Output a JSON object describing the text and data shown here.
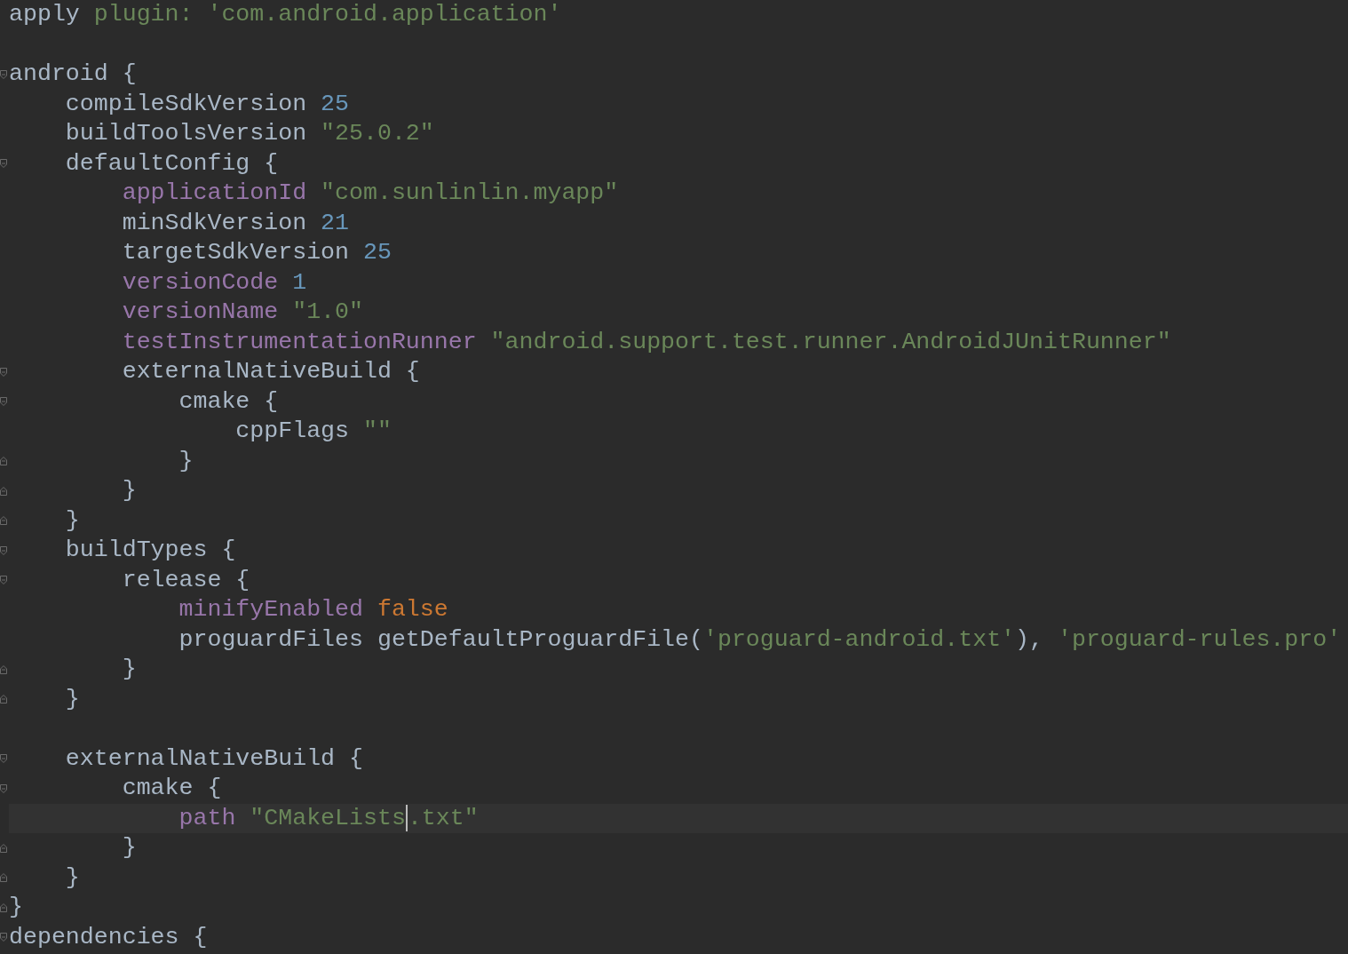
{
  "editor": {
    "lines": [
      {
        "fold_open": false,
        "fold_close": false,
        "tokens": [
          {
            "kind": "plain",
            "text": "apply "
          },
          {
            "kind": "string",
            "text": "plugin: 'com.android.application'"
          }
        ]
      },
      {
        "fold_open": false,
        "fold_close": false
      },
      {
        "fold_open": true,
        "fold_close": false,
        "tokens": [
          {
            "kind": "plain",
            "text": "android {"
          }
        ]
      },
      {
        "fold_open": false,
        "fold_close": false,
        "tokens": [
          {
            "kind": "plain",
            "text": "    compileSdkVersion "
          },
          {
            "kind": "number",
            "text": "25"
          }
        ]
      },
      {
        "fold_open": false,
        "fold_close": false,
        "tokens": [
          {
            "kind": "plain",
            "text": "    buildToolsVersion "
          },
          {
            "kind": "string",
            "text": "\"25.0.2\""
          }
        ]
      },
      {
        "fold_open": true,
        "fold_close": false,
        "tokens": [
          {
            "kind": "plain",
            "text": "    defaultConfig {"
          }
        ]
      },
      {
        "fold_open": false,
        "fold_close": false,
        "tokens": [
          {
            "kind": "property",
            "text": "        applicationId "
          },
          {
            "kind": "string",
            "text": "\"com.sunlinlin.myapp\""
          }
        ]
      },
      {
        "fold_open": false,
        "fold_close": false,
        "tokens": [
          {
            "kind": "plain",
            "text": "        minSdkVersion "
          },
          {
            "kind": "number",
            "text": "21"
          }
        ]
      },
      {
        "fold_open": false,
        "fold_close": false,
        "tokens": [
          {
            "kind": "plain",
            "text": "        targetSdkVersion "
          },
          {
            "kind": "number",
            "text": "25"
          }
        ]
      },
      {
        "fold_open": false,
        "fold_close": false,
        "tokens": [
          {
            "kind": "property",
            "text": "        versionCode "
          },
          {
            "kind": "number",
            "text": "1"
          }
        ]
      },
      {
        "fold_open": false,
        "fold_close": false,
        "tokens": [
          {
            "kind": "property",
            "text": "        versionName "
          },
          {
            "kind": "string",
            "text": "\"1.0\""
          }
        ]
      },
      {
        "fold_open": false,
        "fold_close": false,
        "tokens": [
          {
            "kind": "property",
            "text": "        testInstrumentationRunner "
          },
          {
            "kind": "string",
            "text": "\"android.support.test.runner.AndroidJUnitRunner\""
          }
        ]
      },
      {
        "fold_open": true,
        "fold_close": false,
        "tokens": [
          {
            "kind": "plain",
            "text": "        externalNativeBuild {"
          }
        ]
      },
      {
        "fold_open": true,
        "fold_close": false,
        "tokens": [
          {
            "kind": "plain",
            "text": "            cmake {"
          }
        ]
      },
      {
        "fold_open": false,
        "fold_close": false,
        "tokens": [
          {
            "kind": "plain",
            "text": "                cppFlags "
          },
          {
            "kind": "string",
            "text": "\"\""
          }
        ]
      },
      {
        "fold_open": false,
        "fold_close": true,
        "tokens": [
          {
            "kind": "plain",
            "text": "            }"
          }
        ]
      },
      {
        "fold_open": false,
        "fold_close": true,
        "tokens": [
          {
            "kind": "plain",
            "text": "        }"
          }
        ]
      },
      {
        "fold_open": false,
        "fold_close": true,
        "tokens": [
          {
            "kind": "plain",
            "text": "    }"
          }
        ]
      },
      {
        "fold_open": true,
        "fold_close": false,
        "tokens": [
          {
            "kind": "plain",
            "text": "    buildTypes {"
          }
        ]
      },
      {
        "fold_open": true,
        "fold_close": false,
        "tokens": [
          {
            "kind": "plain",
            "text": "        release {"
          }
        ]
      },
      {
        "fold_open": false,
        "fold_close": false,
        "tokens": [
          {
            "kind": "property",
            "text": "            minifyEnabled "
          },
          {
            "kind": "keyword",
            "text": "false"
          }
        ]
      },
      {
        "fold_open": false,
        "fold_close": false,
        "tokens": [
          {
            "kind": "plain",
            "text": "            proguardFiles getDefaultProguardFile("
          },
          {
            "kind": "string",
            "text": "'proguard-android.txt'"
          },
          {
            "kind": "plain",
            "text": "), "
          },
          {
            "kind": "string",
            "text": "'proguard-rules.pro'"
          }
        ]
      },
      {
        "fold_open": false,
        "fold_close": true,
        "tokens": [
          {
            "kind": "plain",
            "text": "        }"
          }
        ]
      },
      {
        "fold_open": false,
        "fold_close": true,
        "tokens": [
          {
            "kind": "plain",
            "text": "    }"
          }
        ]
      },
      {
        "fold_open": false,
        "fold_close": false
      },
      {
        "fold_open": true,
        "fold_close": false,
        "tokens": [
          {
            "kind": "plain",
            "text": "    externalNativeBuild {"
          }
        ]
      },
      {
        "fold_open": true,
        "fold_close": false,
        "tokens": [
          {
            "kind": "plain",
            "text": "        cmake {"
          }
        ]
      },
      {
        "fold_open": false,
        "fold_close": false,
        "tokens": [
          {
            "kind": "property",
            "text": "            path "
          },
          {
            "kind": "string",
            "text": "\"CMakeLists",
            "caret": true
          },
          {
            "kind": "string",
            "text": ".txt\""
          }
        ]
      },
      {
        "fold_open": false,
        "fold_close": true,
        "tokens": [
          {
            "kind": "plain",
            "text": "        }"
          }
        ]
      },
      {
        "fold_open": false,
        "fold_close": true,
        "tokens": [
          {
            "kind": "plain",
            "text": "    }"
          }
        ]
      },
      {
        "fold_open": false,
        "fold_close": true,
        "tokens": [
          {
            "kind": "plain",
            "text": "}"
          }
        ]
      },
      {
        "fold_open": true,
        "fold_close": false,
        "tokens": [
          {
            "kind": "plain",
            "text": "dependencies {"
          }
        ]
      }
    ]
  }
}
